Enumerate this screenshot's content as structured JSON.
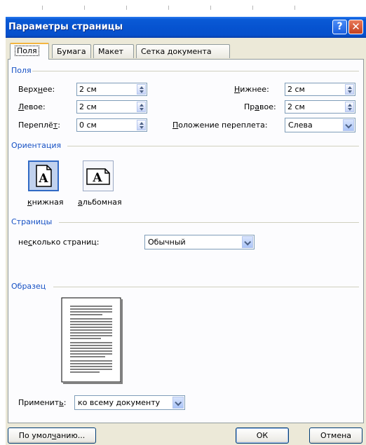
{
  "window": {
    "title": "Параметры страницы",
    "help_glyph": "?",
    "close_glyph": "✕"
  },
  "tabs": [
    {
      "label": "Поля"
    },
    {
      "label": "Бумага"
    },
    {
      "label": "Макет"
    },
    {
      "label": "Сетка документа"
    }
  ],
  "margins": {
    "section_title": "Поля",
    "top": {
      "label_pre": "Верх",
      "label_u": "н",
      "label_post": "ее:",
      "value": "2 см"
    },
    "bottom": {
      "label_pre": "",
      "label_u": "Н",
      "label_post": "ижнее:",
      "value": "2 см"
    },
    "left": {
      "label_pre": "",
      "label_u": "Л",
      "label_post": "евое:",
      "value": "2 см"
    },
    "right": {
      "label_pre": "Пр",
      "label_u": "а",
      "label_post": "вое:",
      "value": "2 см"
    },
    "gutter": {
      "label_pre": "Переплё",
      "label_u": "т",
      "label_post": ":",
      "value": "0 см"
    },
    "gutter_pos": {
      "label_pre": "",
      "label_u": "П",
      "label_post": "оложение переплета:",
      "value": "Слева"
    }
  },
  "orientation": {
    "section_title": "Ориентация",
    "portrait": {
      "label_pre": "",
      "label_u": "к",
      "label_post": "нижная",
      "glyph": "A",
      "selected": true
    },
    "landscape": {
      "label_pre": "",
      "label_u": "а",
      "label_post": "льбомная",
      "glyph": "A",
      "selected": false
    }
  },
  "pages": {
    "section_title": "Страницы",
    "multiple_label_pre": "не",
    "multiple_label_u": "с",
    "multiple_label_post": "колько страниц:",
    "multiple_value": "Обычный"
  },
  "preview": {
    "section_title": "Образец"
  },
  "apply": {
    "label_pre": "Применит",
    "label_u": "ь",
    "label_post": ":",
    "value": "ко всему документу"
  },
  "buttons": {
    "default_pre": "По умол",
    "default_u": "ч",
    "default_post": "анию...",
    "ok": "ОК",
    "cancel": "Отмена"
  },
  "colors": {
    "titlebar": "#0653d0",
    "dialog_bg": "#ece9d8",
    "section_title": "#1651c4",
    "selection": "#316ac5"
  }
}
